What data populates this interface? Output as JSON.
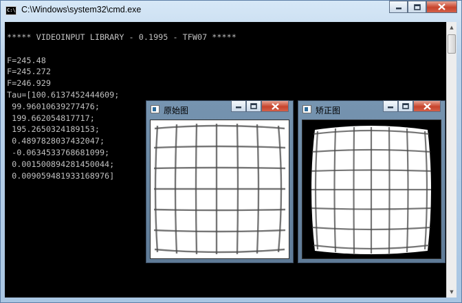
{
  "window": {
    "title": "C:\\Windows\\system32\\cmd.exe",
    "icon": "cmd-icon",
    "icon_text": "C:\\",
    "buttons": [
      "minimize",
      "maximize",
      "close"
    ]
  },
  "console": {
    "lines": [
      "***** VIDEOINPUT LIBRARY - 0.1995 - TFW07 *****",
      "",
      "F=245.48",
      "F=245.272",
      "F=246.929",
      "Tau=[100.6137452444609;",
      " 99.96010639277476;",
      " 199.662054817717;",
      " 195.2650324189153;",
      " 0.4897828037432047;",
      " -0.0634533768681099;",
      " 0.001500894281450044;",
      " 0.009059481933168976]"
    ]
  },
  "image_windows": [
    {
      "title": "原始图",
      "icon": "image-window-icon",
      "content": "distorted checkerboard grid"
    },
    {
      "title": "矫正图",
      "icon": "image-window-icon",
      "content": "corrected grid on black background"
    }
  ],
  "colors": {
    "console_bg": "#000000",
    "console_text": "#c0c0c0",
    "close_button": "#c7442c"
  }
}
